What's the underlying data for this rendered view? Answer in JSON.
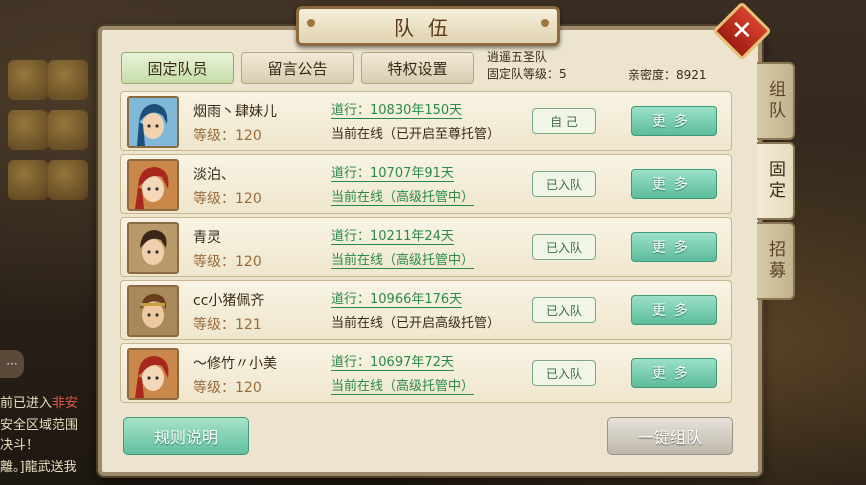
{
  "dialog": {
    "title": "队伍",
    "close_label": "✕"
  },
  "tabs": [
    {
      "label": "固定队员",
      "active": true
    },
    {
      "label": "留言公告",
      "active": false
    },
    {
      "label": "特权设置",
      "active": false
    }
  ],
  "team": {
    "name": "逍遥五圣队",
    "level_label": "固定队等级：5",
    "intimacy_label": "亲密度：8921"
  },
  "members": [
    {
      "name": "烟雨丶肆妹儿",
      "level": "等级：120",
      "dao": "道行：10830年150天",
      "online": "当前在线（已开启至尊托管）",
      "online_underlined": false,
      "status": "自 己",
      "more": "更多"
    },
    {
      "name": "淡泊、",
      "level": "等级：120",
      "dao": "道行：10707年91天",
      "online": "当前在线（高级托管中）",
      "online_underlined": true,
      "status": "已入队",
      "more": "更多"
    },
    {
      "name": "青灵",
      "level": "等级：120",
      "dao": "道行：10211年24天",
      "online": "当前在线（高级托管中）",
      "online_underlined": true,
      "status": "已入队",
      "more": "更多"
    },
    {
      "name": "cc小猪佩齐",
      "level": "等级：121",
      "dao": "道行：10966年176天",
      "online": "当前在线（已开启高级托管）",
      "online_underlined": false,
      "status": "已入队",
      "more": "更多"
    },
    {
      "name": "～修竹〃小美",
      "level": "等级：120",
      "dao": "道行：10697年72天",
      "online": "当前在线（高级托管中）",
      "online_underlined": true,
      "status": "已入队",
      "more": "更多"
    }
  ],
  "buttons": {
    "rules": "规则说明",
    "form_team": "一键组队"
  },
  "side_tabs": [
    {
      "label": "组队",
      "active": false
    },
    {
      "label": "固定",
      "active": true
    },
    {
      "label": "招募",
      "active": false
    }
  ],
  "background": {
    "chat_lines": [
      "前已进入",
      "非安",
      "安全区域范围",
      "决斗！",
      "離。]龍武送我"
    ],
    "chat_bubble": "···"
  },
  "colors": {
    "accent_green": "#5cbc9c",
    "close_red": "#c0301e",
    "dao_green": "#2a8a4a"
  }
}
